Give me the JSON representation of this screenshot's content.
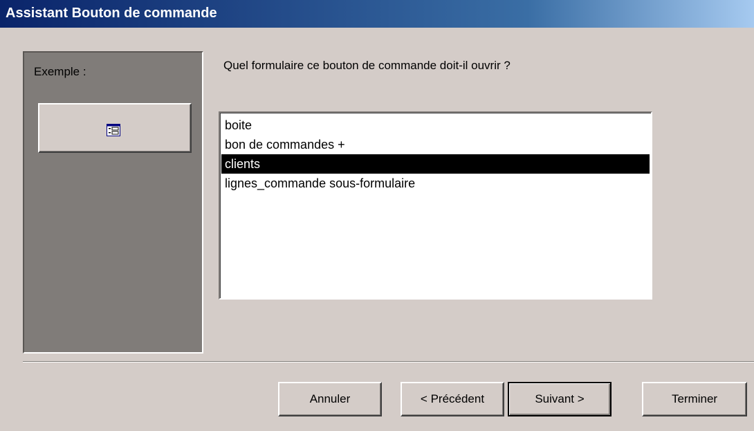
{
  "window": {
    "title": "Assistant Bouton de commande"
  },
  "example": {
    "label": "Exemple :",
    "icon": "form-icon"
  },
  "question": "Quel formulaire ce bouton de commande doit-il ouvrir ?",
  "forms": [
    {
      "label": "boite",
      "selected": false
    },
    {
      "label": "bon de commandes +",
      "selected": false
    },
    {
      "label": "clients",
      "selected": true
    },
    {
      "label": "lignes_commande sous-formulaire",
      "selected": false
    }
  ],
  "buttons": {
    "cancel": "Annuler",
    "back": "< Précédent",
    "next": "Suivant >",
    "finish": "Terminer"
  }
}
